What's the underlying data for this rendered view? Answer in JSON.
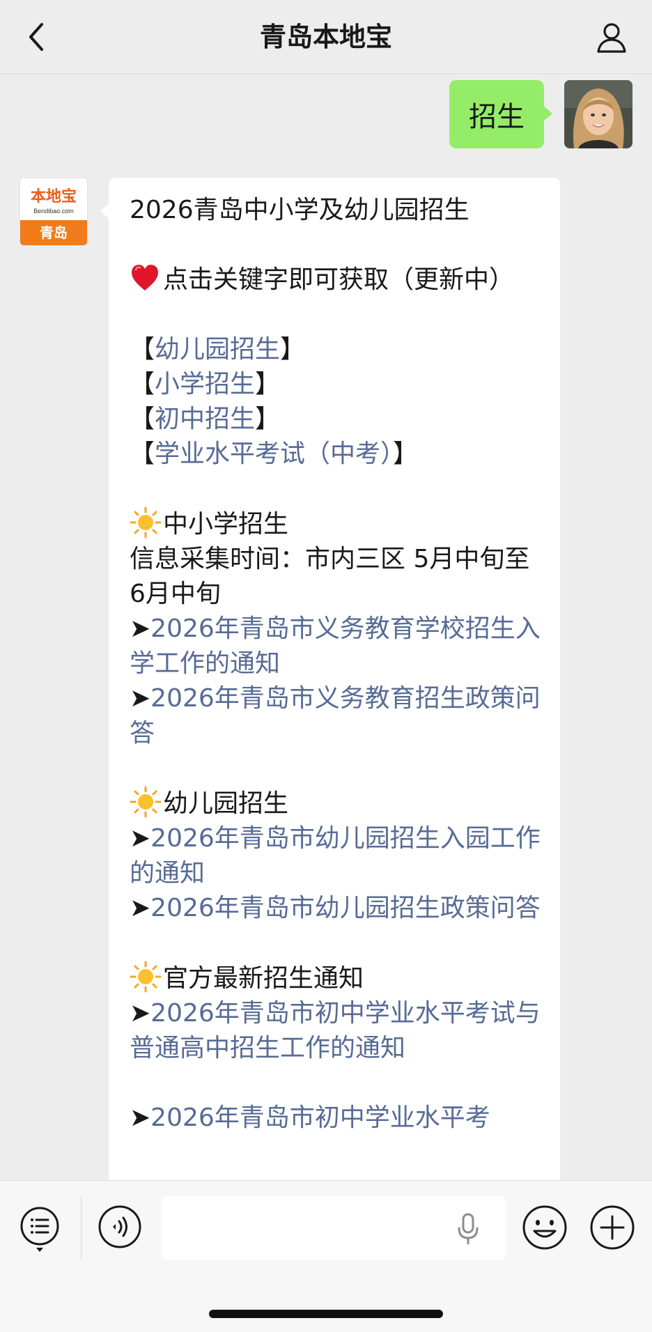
{
  "navbar": {
    "title": "青岛本地宝",
    "back_icon": "chevron-left-icon",
    "profile_icon": "person-icon"
  },
  "user_message": {
    "text": "招生",
    "bubble_color": "#95ec69"
  },
  "bot_avatar": {
    "logo_main": "本地宝",
    "logo_sub": "Bendibao.com",
    "logo_city": "青岛",
    "accent_color": "#f07c1b"
  },
  "bot_message": {
    "title": "2026青岛中小学及幼儿园招生",
    "prompt": "点击关键字即可获取（更新中）",
    "prompt_icon": "heart-icon",
    "keywords": [
      {
        "open": "【",
        "label": "幼儿园招生",
        "close": "】"
      },
      {
        "open": "【",
        "label": "小学招生",
        "close": "】"
      },
      {
        "open": "【",
        "label": "初中招生",
        "close": "】"
      },
      {
        "open": "【",
        "label": "学业水平考试（中考）",
        "close": "】"
      }
    ],
    "arrow": "➤",
    "section_icon": "sun-icon",
    "sections": [
      {
        "heading": "中小学招生",
        "info": "信息采集时间：市内三区 5月中旬至6月中旬",
        "links": [
          "2026年青岛市义务教育学校招生入学工作的通知",
          "2026年青岛市义务教育招生政策问答"
        ]
      },
      {
        "heading": "幼儿园招生",
        "links": [
          "2026年青岛市幼儿园招生入园工作的通知",
          "2026年青岛市幼儿园招生政策问答"
        ]
      },
      {
        "heading": "官方最新招生通知",
        "links": [
          "2026年青岛市初中学业水平考试与普通高中招生工作的通知",
          "2026年青岛市初中学业水平考"
        ]
      }
    ],
    "link_color": "#576b95"
  },
  "bottombar": {
    "menu_icon": "list-menu-icon",
    "voice_icon": "voice-icon",
    "input_value": "",
    "mic_icon": "microphone-icon",
    "emoji_icon": "emoji-icon",
    "plus_icon": "plus-icon"
  }
}
